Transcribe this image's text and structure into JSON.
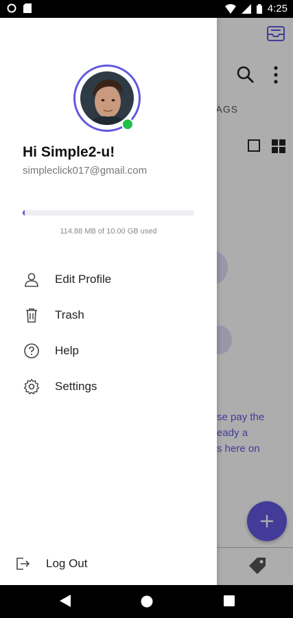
{
  "status_bar": {
    "time": "4:25"
  },
  "background": {
    "tags_label": "TAGS",
    "promo_lines": [
      "se pay the",
      "eady a",
      "s here on"
    ],
    "accent": "#6257e0"
  },
  "drawer": {
    "greeting": "Hi Simple2-u!",
    "email": "simpleclick017@gmail.com",
    "storage_text": "114.88 MB of 10.00 GB used",
    "storage_fraction": 0.0112,
    "menu": [
      {
        "label": "Edit Profile",
        "icon": "person-icon"
      },
      {
        "label": "Trash",
        "icon": "trash-icon"
      },
      {
        "label": "Help",
        "icon": "help-icon"
      },
      {
        "label": "Settings",
        "icon": "gear-icon"
      }
    ],
    "logout_label": "Log Out"
  }
}
